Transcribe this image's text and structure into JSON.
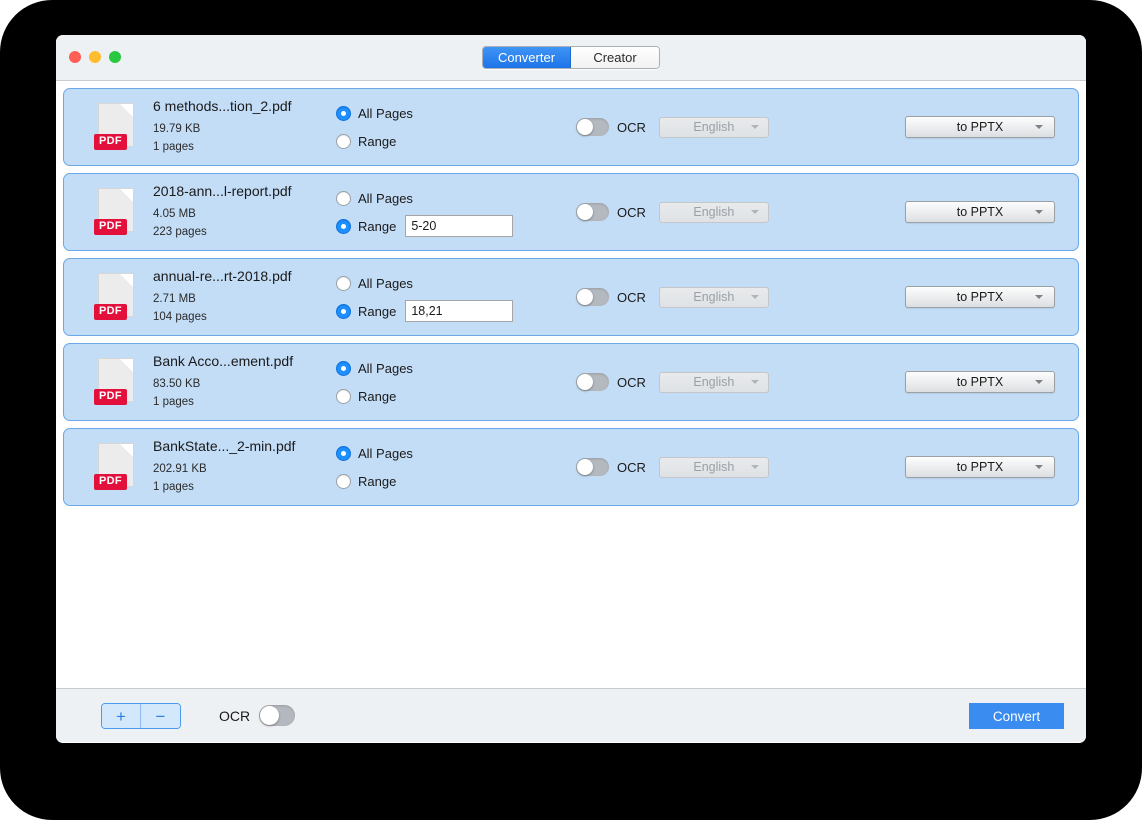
{
  "window": {
    "traffic_lights": [
      "close",
      "minimize",
      "zoom"
    ],
    "tabs": [
      {
        "label": "Converter",
        "active": true
      },
      {
        "label": "Creator",
        "active": false
      }
    ]
  },
  "labels": {
    "all_pages": "All Pages",
    "range": "Range",
    "ocr": "OCR",
    "range_placeholder": ""
  },
  "files": [
    {
      "name": "6 methods...tion_2.pdf",
      "size": "19.79 KB",
      "pages": "1 pages",
      "badge": "PDF",
      "mode": "all",
      "range_value": "",
      "ocr_enabled": false,
      "language": "English",
      "format": "to PPTX"
    },
    {
      "name": "2018-ann...l-report.pdf",
      "size": "4.05 MB",
      "pages": "223 pages",
      "badge": "PDF",
      "mode": "range",
      "range_value": "5-20",
      "ocr_enabled": false,
      "language": "English",
      "format": "to PPTX"
    },
    {
      "name": "annual-re...rt-2018.pdf",
      "size": "2.71 MB",
      "pages": "104 pages",
      "badge": "PDF",
      "mode": "range",
      "range_value": "18,21",
      "ocr_enabled": false,
      "language": "English",
      "format": "to PPTX"
    },
    {
      "name": "Bank Acco...ement.pdf",
      "size": "83.50 KB",
      "pages": "1 pages",
      "badge": "PDF",
      "mode": "all",
      "range_value": "",
      "ocr_enabled": false,
      "language": "English",
      "format": "to PPTX"
    },
    {
      "name": "BankState..._2-min.pdf",
      "size": "202.91 KB",
      "pages": "1 pages",
      "badge": "PDF",
      "mode": "all",
      "range_value": "",
      "ocr_enabled": false,
      "language": "English",
      "format": "to PPTX"
    }
  ],
  "toolbar": {
    "add_label": "+",
    "remove_label": "−",
    "ocr_label": "OCR",
    "ocr_enabled": false,
    "convert_label": "Convert"
  },
  "colors": {
    "accent": "#3b8cf0",
    "row_fill": "#c3ddf7",
    "row_border": "#6aa8e8",
    "badge_red": "#e3103c",
    "chrome": "#eef1f4"
  }
}
